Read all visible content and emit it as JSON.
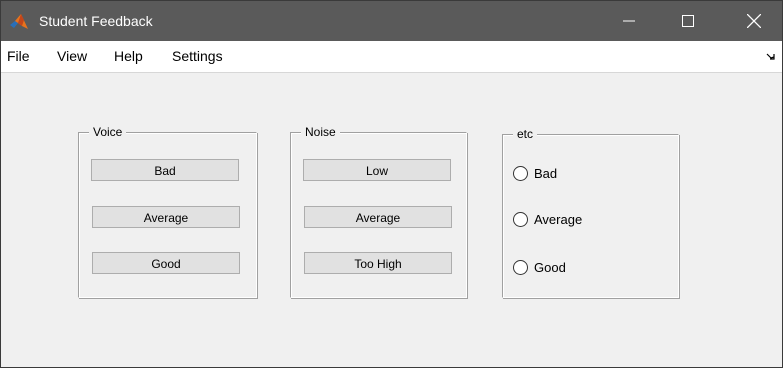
{
  "window": {
    "title": "Student Feedback"
  },
  "menubar": {
    "items": [
      {
        "label": "File"
      },
      {
        "label": "View"
      },
      {
        "label": "Help"
      },
      {
        "label": "Settings"
      }
    ]
  },
  "panels": {
    "voice": {
      "title": "Voice",
      "buttons": [
        {
          "label": "Bad"
        },
        {
          "label": "Average"
        },
        {
          "label": "Good"
        }
      ]
    },
    "noise": {
      "title": "Noise",
      "buttons": [
        {
          "label": "Low"
        },
        {
          "label": "Average"
        },
        {
          "label": "Too High"
        }
      ]
    },
    "etc": {
      "title": "etc",
      "radios": [
        {
          "label": "Bad",
          "checked": false
        },
        {
          "label": "Average",
          "checked": false
        },
        {
          "label": "Good",
          "checked": false
        }
      ]
    }
  },
  "colors": {
    "titlebar": "#5a5a5a",
    "window_bg": "#f0f0f0",
    "button_bg": "#e1e1e1",
    "icon_orange": "#e8731d",
    "icon_blue": "#2a6fb8"
  }
}
